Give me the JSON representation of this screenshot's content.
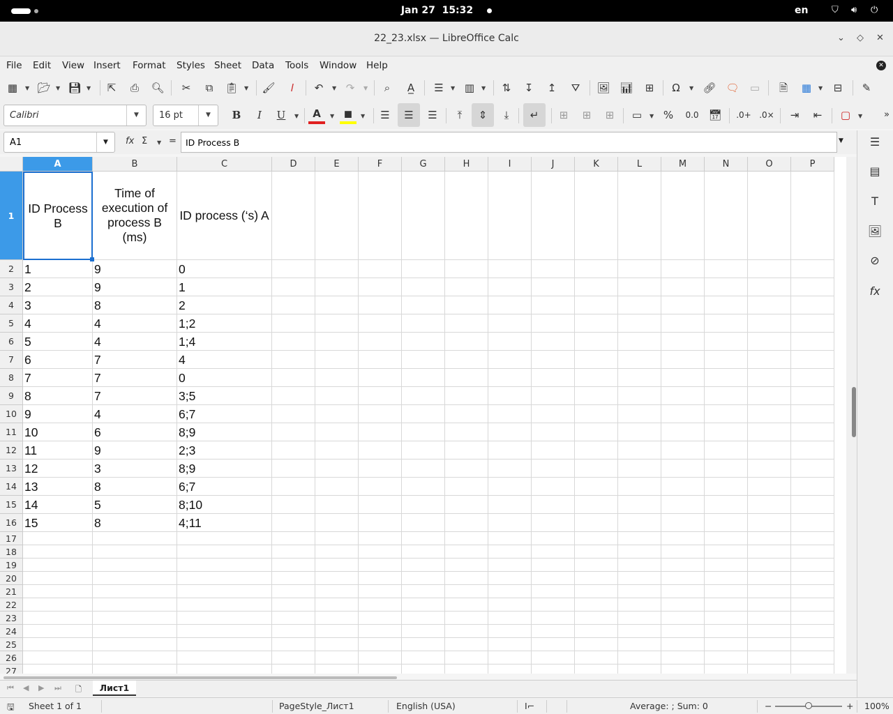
{
  "system": {
    "date": "Jan 27",
    "time": "15:32",
    "language": "en"
  },
  "window": {
    "title": "22_23.xlsx — LibreOffice Calc"
  },
  "menu": [
    "File",
    "Edit",
    "View",
    "Insert",
    "Format",
    "Styles",
    "Sheet",
    "Data",
    "Tools",
    "Window",
    "Help"
  ],
  "format": {
    "font_name": "Calibri",
    "font_size": "16 pt",
    "font_color": "#e02020",
    "highlight_color": "#ffff00"
  },
  "formula_bar": {
    "cell_ref": "A1",
    "content": "ID Process B"
  },
  "sheet": {
    "columns": [
      "A",
      "B",
      "C",
      "D",
      "E",
      "F",
      "G",
      "H",
      "I",
      "J",
      "K",
      "L",
      "M",
      "N",
      "O",
      "P"
    ],
    "row_numbers": [
      "1",
      "2",
      "3",
      "4",
      "5",
      "6",
      "7",
      "8",
      "9",
      "10",
      "11",
      "12",
      "13",
      "14",
      "15",
      "16",
      "17",
      "18",
      "19",
      "20",
      "21",
      "22",
      "23",
      "24",
      "25",
      "26",
      "27"
    ],
    "header": [
      "ID Process B",
      "Time of execution of process B (ms)",
      "ID process (‘s) A"
    ],
    "rows": [
      [
        "1",
        "9",
        "0"
      ],
      [
        "2",
        "9",
        "1"
      ],
      [
        "3",
        "8",
        "2"
      ],
      [
        "4",
        "4",
        "1;2"
      ],
      [
        "5",
        "4",
        "1;4"
      ],
      [
        "6",
        "7",
        "4"
      ],
      [
        "7",
        "7",
        "0"
      ],
      [
        "8",
        "7",
        "3;5"
      ],
      [
        "9",
        "4",
        "6;7"
      ],
      [
        "10",
        "6",
        "8;9"
      ],
      [
        "11",
        "9",
        "2;3"
      ],
      [
        "12",
        "3",
        "8;9"
      ],
      [
        "13",
        "8",
        "6;7"
      ],
      [
        "14",
        "5",
        "8;10"
      ],
      [
        "15",
        "8",
        "4;11"
      ]
    ],
    "selected_color": "#3c9ae8"
  },
  "tabs": {
    "active": "Лист1"
  },
  "status": {
    "sheet_pos": "Sheet 1 of 1",
    "page_style": "PageStyle_Лист1",
    "locale": "English (USA)",
    "summary": "Average: ; Sum: 0",
    "zoom": "100%"
  }
}
